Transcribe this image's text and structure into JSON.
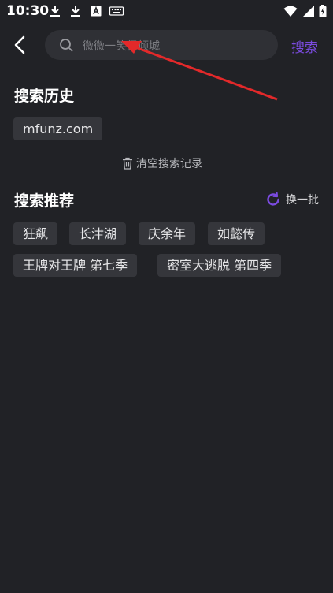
{
  "status_bar": {
    "time": "10:30",
    "icons": [
      "download-icon",
      "download-icon",
      "text-icon",
      "keyboard-icon",
      "wifi-icon",
      "signal-icon",
      "battery-icon"
    ]
  },
  "header": {
    "back_icon": "back-arrow-icon",
    "search_placeholder": "微微一笑很倾城",
    "search_button": "搜索",
    "accent_color": "#7b4be0"
  },
  "history": {
    "title": "搜索历史",
    "items": [
      "mfunz.com"
    ],
    "clear_label": "清空搜索记录"
  },
  "recommend": {
    "title": "搜索推荐",
    "refresh_label": "换一批",
    "items": [
      "狂飙",
      "长津湖",
      "庆余年",
      "如懿传",
      "王牌对王牌 第七季",
      "密室大逃脱 第四季"
    ]
  },
  "colors": {
    "background": "#212226",
    "chip_background": "#35363b",
    "annotation_arrow": "#e3292a"
  }
}
